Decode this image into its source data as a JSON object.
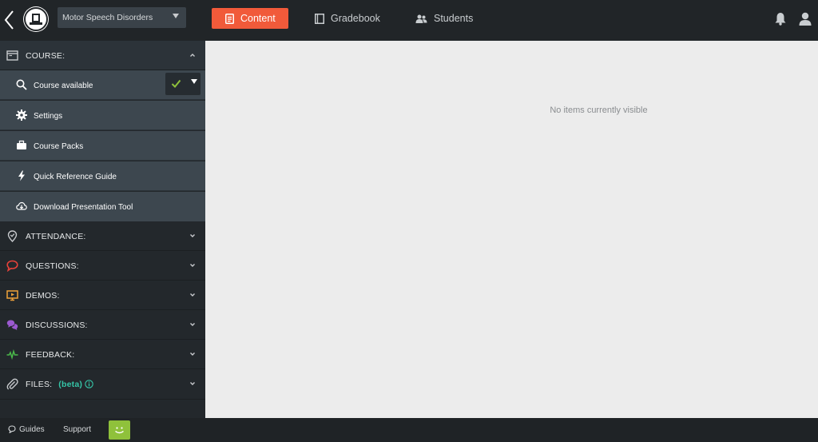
{
  "topbar": {
    "course_name": "Motor Speech Disorders",
    "tabs": [
      {
        "label": "Content",
        "active": true,
        "icon": "document-icon"
      },
      {
        "label": "Gradebook",
        "active": false,
        "icon": "book-icon"
      },
      {
        "label": "Students",
        "active": false,
        "icon": "people-icon"
      }
    ],
    "accent_color": "#f15a3a"
  },
  "sidebar": {
    "course": {
      "title": "COURSE:",
      "items": [
        {
          "label": "Course available",
          "icon": "search-icon",
          "available": true
        },
        {
          "label": "Settings",
          "icon": "gear-icon"
        },
        {
          "label": "Course Packs",
          "icon": "briefcase-icon"
        },
        {
          "label": "Quick Reference Guide",
          "icon": "bolt-icon"
        },
        {
          "label": "Download Presentation Tool",
          "icon": "cloud-download-icon"
        }
      ]
    },
    "sections": [
      {
        "title": "ATTENDANCE:",
        "icon": "location-pin-icon",
        "color": "#c8cbce"
      },
      {
        "title": "QUESTIONS:",
        "icon": "speech-bubble-icon",
        "color": "#e8423a"
      },
      {
        "title": "DEMOS:",
        "icon": "monitor-icon",
        "color": "#f0a23a"
      },
      {
        "title": "DISCUSSIONS:",
        "icon": "chat-bubbles-icon",
        "color": "#9b59d0"
      },
      {
        "title": "FEEDBACK:",
        "icon": "pulse-icon",
        "color": "#4ab84a"
      },
      {
        "title": "FILES:",
        "beta": "(beta)",
        "icon": "paperclip-icon",
        "color": "#c8cbce"
      }
    ]
  },
  "main": {
    "empty_message": "No items currently visible"
  },
  "footer": {
    "guides": "Guides",
    "support": "Support",
    "smiley_color": "#8fc13b"
  }
}
